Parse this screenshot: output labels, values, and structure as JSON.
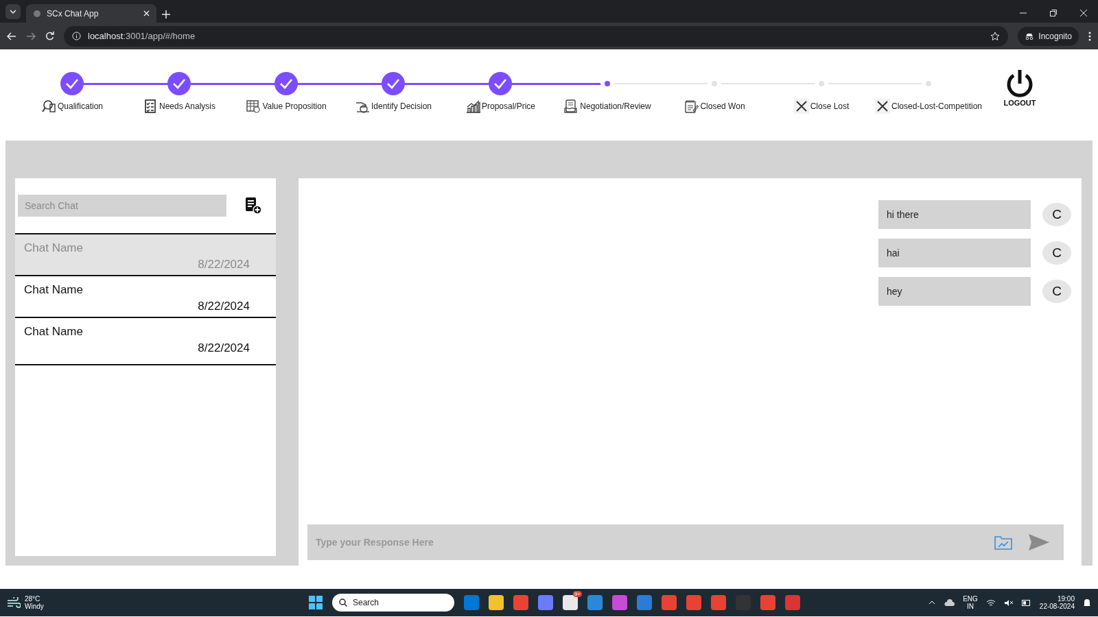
{
  "browser": {
    "tab_title": "SCx Chat App",
    "url_host": "localhost",
    "url_path": ":3001/app/#/home",
    "profile_label": "Incognito"
  },
  "stepper": {
    "steps": [
      {
        "label": "Qualification",
        "kind": "done"
      },
      {
        "label": "Needs Analysis",
        "kind": "done"
      },
      {
        "label": "Value Proposition",
        "kind": "done"
      },
      {
        "label": "Identify Decision",
        "kind": "done"
      },
      {
        "label": "Proposal/Price",
        "kind": "done"
      },
      {
        "label": "Negotiation/Review",
        "kind": "current"
      },
      {
        "label": "Closed Won",
        "kind": "pending"
      },
      {
        "label": "Close Lost",
        "kind": "pending"
      },
      {
        "label": "Closed-Lost-Competition",
        "kind": "pending"
      }
    ]
  },
  "logout": {
    "label": "LOGOUT"
  },
  "chat_list": {
    "search_placeholder": "Search Chat",
    "chats": [
      {
        "name": "Chat Name",
        "date": "8/22/2024",
        "selected": true
      },
      {
        "name": "Chat Name",
        "date": "8/22/2024",
        "selected": false
      },
      {
        "name": "Chat Name",
        "date": "8/22/2024",
        "selected": false
      }
    ]
  },
  "conversation": {
    "messages": [
      {
        "text": "hi there",
        "avatar": "C"
      },
      {
        "text": "hai",
        "avatar": "C"
      },
      {
        "text": "hey",
        "avatar": "C"
      }
    ],
    "composer_placeholder": "Type your Response Here"
  },
  "taskbar": {
    "temperature": "28°C",
    "weather": "Windy",
    "search_placeholder": "Search",
    "mail_badge": "9+",
    "language": "ENG",
    "region": "IN",
    "time": "19:00",
    "date": "22-08-2024"
  }
}
